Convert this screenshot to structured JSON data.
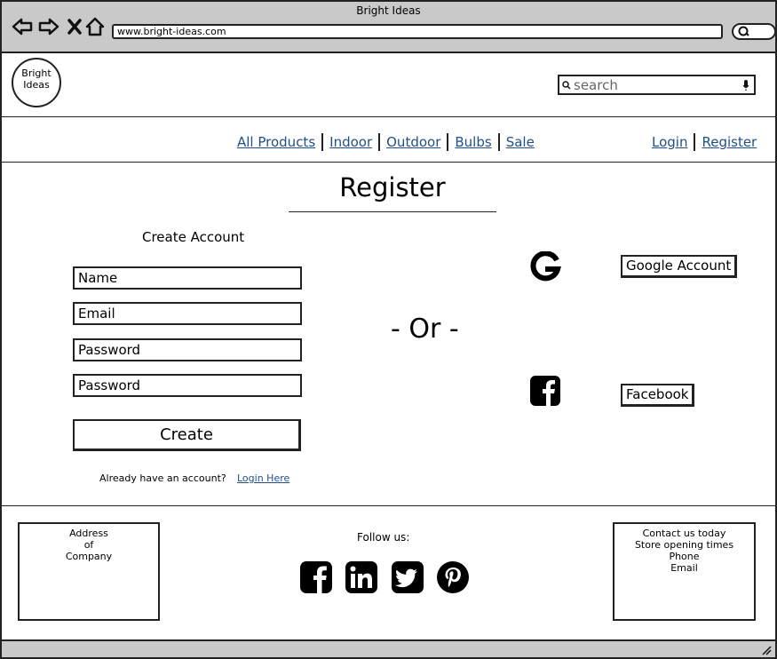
{
  "window": {
    "title": "Bright Ideas",
    "url": "www.bright-ideas.com"
  },
  "header": {
    "logo_line1": "Bright",
    "logo_line2": "Ideas",
    "search_placeholder": "search"
  },
  "nav": {
    "items": [
      "All Products",
      "Indoor",
      "Outdoor",
      "Bulbs",
      "Sale"
    ],
    "login": "Login",
    "register": "Register"
  },
  "main": {
    "title": "Register",
    "create_account": "Create Account",
    "fields": [
      "Name",
      "Email",
      "Password",
      "Password"
    ],
    "create_button": "Create",
    "already": "Already have an account?",
    "login_here": "Login Here",
    "or": "- Or -",
    "google_button": "Google Account",
    "facebook_button": "Facebook"
  },
  "footer": {
    "address": [
      "Address",
      "of",
      "Company"
    ],
    "follow": "Follow us:",
    "contact": [
      "Contact us today",
      "Store opening times",
      "Phone",
      "Email"
    ],
    "social_icons": [
      "facebook-icon",
      "linkedin-icon",
      "twitter-icon",
      "pinterest-icon"
    ]
  }
}
